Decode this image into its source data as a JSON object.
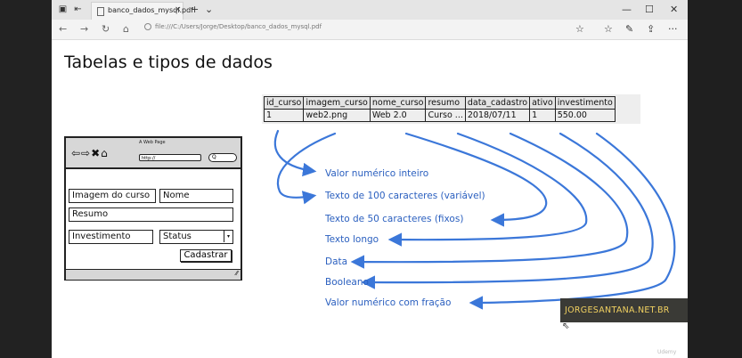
{
  "browser": {
    "tab_title": "banco_dados_mysql.pdf",
    "tab_close": "×",
    "new_tab": "+",
    "tabs_menu": "⌄",
    "address": "file:///C:/Users/Jorge/Desktop/banco_dados_mysql.pdf",
    "window_controls": {
      "minimize": "—",
      "maximize": "☐",
      "close": "✕"
    },
    "nav": {
      "back": "←",
      "forward": "→",
      "refresh": "↻",
      "home": "⌂"
    },
    "toolbar": {
      "star": "☆",
      "favorites": "☆",
      "notes": "✎",
      "share": "⇪",
      "more": "···"
    }
  },
  "slide": {
    "title": "Tabelas e tipos de dados",
    "table": {
      "headers": [
        "id_curso",
        "imagem_curso",
        "nome_curso",
        "resumo",
        "data_cadastro",
        "ativo",
        "investimento"
      ],
      "row": [
        "1",
        "web2.png",
        "Web 2.0",
        "Curso ...",
        "2018/07/11",
        "1",
        "550.00"
      ]
    },
    "mockup": {
      "window_title": "A Web Page",
      "nav_icons": "⇦⇨✖⌂",
      "url_value": "http://",
      "search_value": "Q",
      "fields": {
        "imagem": "Imagem do curso",
        "nome": "Nome",
        "resumo": "Resumo",
        "investimento": "Investimento",
        "status": "Status"
      },
      "select_arrow": "▾",
      "submit": "Cadastrar",
      "resize_glyph": "⁄⁄"
    },
    "type_labels": [
      "Valor numérico inteiro",
      "Texto de 100 caracteres (variável)",
      "Texto de 50 caracteres (fixos)",
      "Texto longo",
      "Data",
      "Booleano",
      "Valor numérico com fração"
    ],
    "arrow_color": "#3b77d9",
    "badge": "JORGESANTANA.NET.BR",
    "watermark": "Udemy"
  }
}
